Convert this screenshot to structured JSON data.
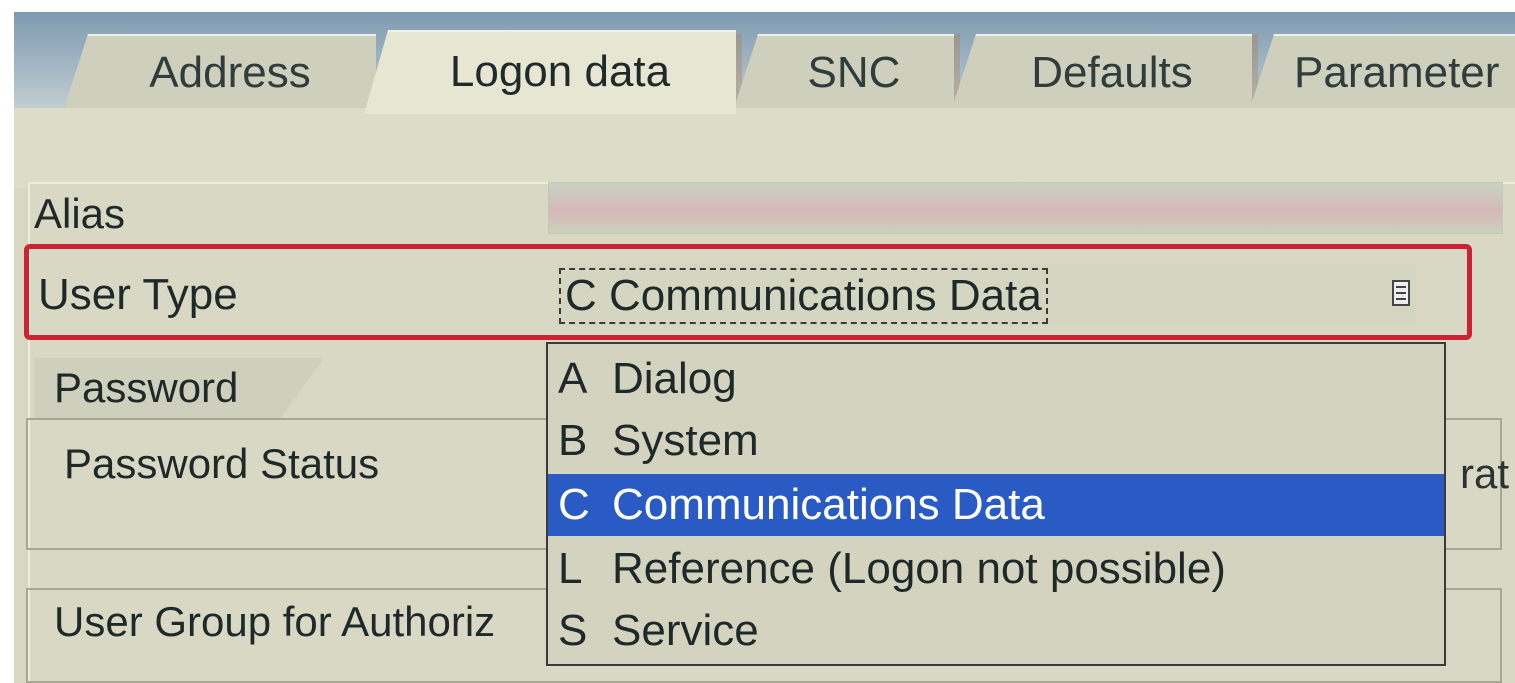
{
  "tabs": [
    {
      "label": "Address",
      "active": false
    },
    {
      "label": "Logon data",
      "active": true
    },
    {
      "label": "SNC",
      "active": false
    },
    {
      "label": "Defaults",
      "active": false
    },
    {
      "label": "Parameter",
      "active": false
    }
  ],
  "form": {
    "alias_label": "Alias",
    "user_type_label": "User Type",
    "user_type_value": "C Communications Data",
    "password_tab": "Password",
    "password_status_label": "Password Status",
    "right_fragment": "rat",
    "auth_group_label": "User Group for Authoriz"
  },
  "dropdown": {
    "options": [
      {
        "key": "A",
        "label": "Dialog",
        "selected": false
      },
      {
        "key": "B",
        "label": "System",
        "selected": false
      },
      {
        "key": "C",
        "label": "Communications Data",
        "selected": true
      },
      {
        "key": "L",
        "label": "Reference (Logon not possible)",
        "selected": false
      },
      {
        "key": "S",
        "label": "Service",
        "selected": false
      }
    ]
  },
  "colors": {
    "highlight_border": "#cc2233",
    "selected_option": "#2a5ac4",
    "background": "#d7d7c3"
  },
  "icons": {
    "dropdown": "dropdown-list-icon"
  }
}
